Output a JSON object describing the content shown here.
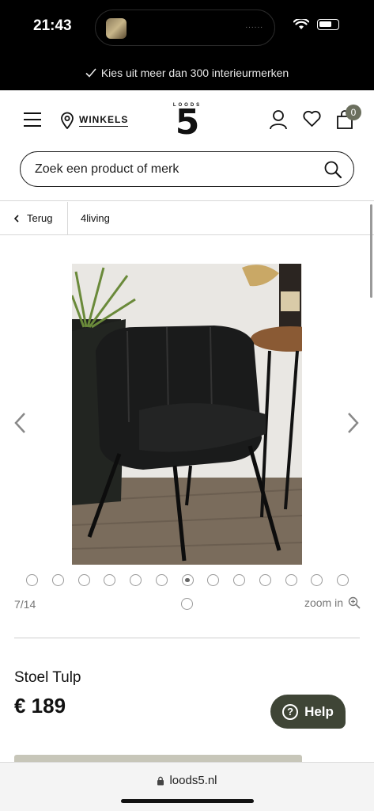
{
  "status_bar": {
    "time": "21:43",
    "indicator_dots": "......"
  },
  "banner": {
    "text": "Kies uit meer dan 300 interieurmerken"
  },
  "header": {
    "stores_label": "WINKELS",
    "logo_small": "LOODS",
    "logo_big": "5",
    "cart_count": "0"
  },
  "search": {
    "placeholder": "Zoek een product of merk"
  },
  "breadcrumb": {
    "back_label": "Terug",
    "current": "4living"
  },
  "gallery": {
    "counter": "7/14",
    "zoom_label": "zoom in",
    "total_images": 14,
    "active_index": 7
  },
  "product": {
    "title": "Stoel Tulp",
    "price": "€ 189"
  },
  "help": {
    "label": "Help"
  },
  "browser": {
    "url": "loods5.nl"
  },
  "colors": {
    "accent": "#6b6f5e",
    "help_bg": "#3f4536",
    "cta": "#c7c6b9"
  }
}
